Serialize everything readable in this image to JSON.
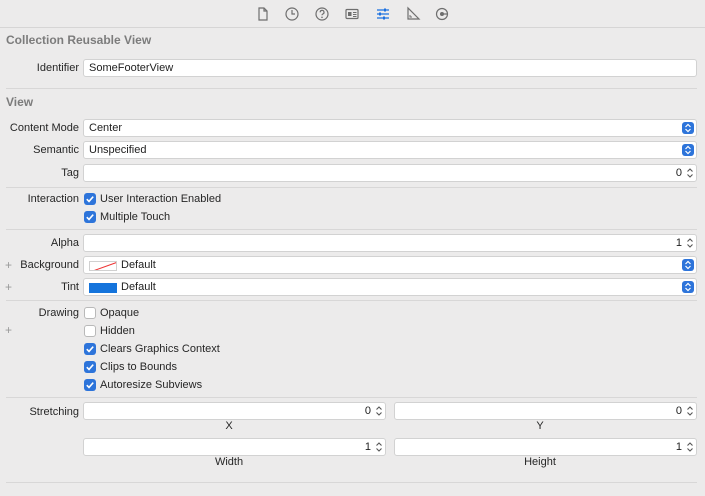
{
  "toolbar": {
    "icons": [
      "file-icon",
      "history-icon",
      "help-icon",
      "identity-icon",
      "attributes-icon",
      "size-icon",
      "connections-icon"
    ],
    "active": "attributes-icon"
  },
  "crv": {
    "title": "Collection Reusable View",
    "identifier_label": "Identifier",
    "identifier_value": "SomeFooterView"
  },
  "view": {
    "title": "View",
    "content_mode_label": "Content Mode",
    "content_mode_value": "Center",
    "semantic_label": "Semantic",
    "semantic_value": "Unspecified",
    "tag_label": "Tag",
    "tag_value": "0",
    "interaction_label": "Interaction",
    "user_interaction": {
      "label": "User Interaction Enabled",
      "checked": true
    },
    "multiple_touch": {
      "label": "Multiple Touch",
      "checked": true
    },
    "alpha_label": "Alpha",
    "alpha_value": "1",
    "background_label": "Background",
    "background_value": "Default",
    "tint_label": "Tint",
    "tint_value": "Default",
    "tint_color": "#1574dc",
    "plus": "+",
    "drawing_label": "Drawing",
    "opaque": {
      "label": "Opaque",
      "checked": false
    },
    "hidden": {
      "label": "Hidden",
      "checked": false
    },
    "clears": {
      "label": "Clears Graphics Context",
      "checked": true
    },
    "clips": {
      "label": "Clips to Bounds",
      "checked": true
    },
    "autoresize": {
      "label": "Autoresize Subviews",
      "checked": true
    },
    "stretching_label": "Stretching",
    "x_value": "0",
    "x_label": "X",
    "y_value": "0",
    "y_label": "Y",
    "width_value": "1",
    "width_label": "Width",
    "height_value": "1",
    "height_label": "Height"
  },
  "colors": {
    "accent": "#2d74da",
    "background": "#ecebeb"
  }
}
